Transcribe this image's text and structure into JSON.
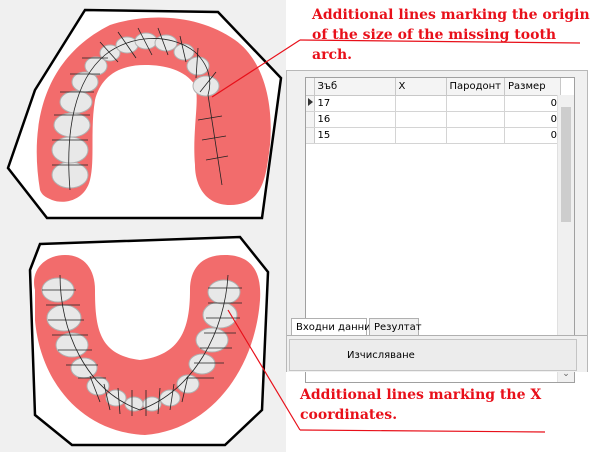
{
  "annotations": {
    "top": "Additional lines marking the origin of the size of the missing tooth arch.",
    "bottom": "Additional lines marking the X coordinates."
  },
  "grid": {
    "headers": [
      "Зъб",
      "X",
      "Пародонт",
      "Размер"
    ],
    "rows": [
      {
        "tooth": "17",
        "x": "",
        "parodont": "",
        "size": "0"
      },
      {
        "tooth": "16",
        "x": "",
        "parodont": "",
        "size": "0"
      },
      {
        "tooth": "15",
        "x": "",
        "parodont": "",
        "size": "0"
      }
    ]
  },
  "tabs": [
    {
      "label": "Входни данни",
      "active": true
    },
    {
      "label": "Резултат",
      "active": false
    }
  ],
  "calculate_button": "Изчисляване",
  "colors": {
    "annotation": "#e8101a",
    "gum": "#f26c6c",
    "tooth": "#e6e6e6"
  },
  "icons": {
    "row_pointer": "triangle-right-icon",
    "scroll_down": "chevron-down-icon"
  }
}
